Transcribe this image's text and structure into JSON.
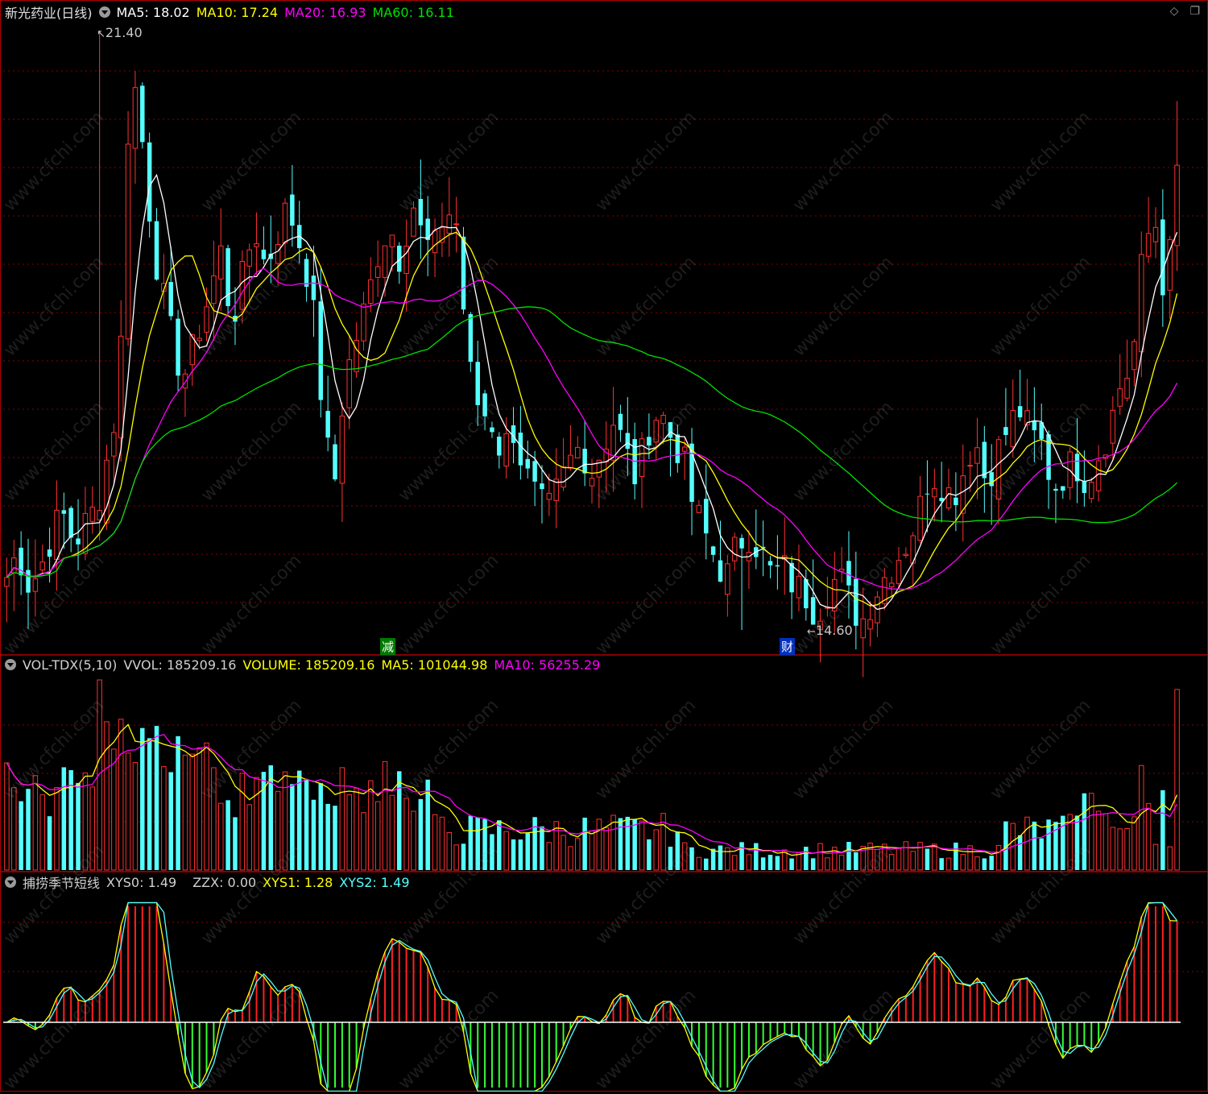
{
  "header_main": {
    "stock": "新光药业(日线)",
    "ma5": "MA5: 18.02",
    "ma10": "MA10: 17.24",
    "ma20": "MA20: 16.93",
    "ma60": "MA60: 16.11"
  },
  "header_vol": {
    "name": "VOL-TDX(5,10)",
    "vvol": "VVOL: 185209.16",
    "volume": "VOLUME: 185209.16",
    "ma5": "MA5: 101044.98",
    "ma10": "MA10: 56255.29"
  },
  "header_ind": {
    "name": "捕捞季节短线",
    "xys0": "XYS0: 1.49",
    "zzx": "ZZX: 0.00",
    "xys1": "XYS1: 1.28",
    "xys2": "XYS2: 1.49"
  },
  "annotations": {
    "high": "21.40",
    "low": "14.60",
    "tag_jian": "减",
    "tag_cai": "财"
  },
  "icons": [
    "diamond-icon",
    "restore-icon"
  ],
  "watermark": "www.cfchi.com",
  "colors": {
    "up": "#ff3030",
    "down": "#54ffff",
    "ma5": "#ffffff",
    "ma10": "#ffff00",
    "ma20": "#ff00ff",
    "ma60": "#00e000",
    "border": "#b00000",
    "grid": "#8a0000",
    "text": "#c8c8c8"
  },
  "chart_data": [
    {
      "type": "candlestick",
      "title": "新光药业(日线)",
      "high_label": 21.4,
      "low_label": 14.6,
      "close_path": [
        15.2,
        15.5,
        15.1,
        15.3,
        15.7,
        15.9,
        15.6,
        15.8,
        16.0,
        16.6,
        17.3,
        21.1,
        20.2,
        19.0,
        18.3,
        17.7,
        17.5,
        18.0,
        18.4,
        18.9,
        18.1,
        18.6,
        19.2,
        18.7,
        19.1,
        19.4,
        19.0,
        18.5,
        17.2,
        16.1,
        17.4,
        17.9,
        18.3,
        18.9,
        19.2,
        18.8,
        19.5,
        19.0,
        18.9,
        19.4,
        19.2,
        17.6,
        17.1,
        17.0,
        16.6,
        16.9,
        16.4,
        16.1,
        15.9,
        16.2,
        16.5,
        16.7,
        16.4,
        16.7,
        17.0,
        16.6,
        16.3,
        16.9,
        17.1,
        16.8,
        16.6,
        16.0,
        15.7,
        15.4,
        15.2,
        15.6,
        15.7,
        15.5,
        15.2,
        15.3,
        15.1,
        15.0,
        14.8,
        15.1,
        15.2,
        14.9,
        14.7,
        15.0,
        15.2,
        15.4,
        15.6,
        15.9,
        16.4,
        16.3,
        16.1,
        16.4,
        16.8,
        16.3,
        16.6,
        16.9,
        17.1,
        16.8,
        16.7,
        16.2,
        16.4,
        16.5,
        16.3,
        16.6,
        16.9,
        17.4,
        17.6,
        18.9,
        19.3,
        18.3,
        19.8
      ]
    },
    {
      "type": "bar",
      "title": "VOL-TDX(5,10)",
      "series": [
        {
          "name": "VOLUME",
          "last": 185209.16
        },
        {
          "name": "MA5",
          "last": 101044.98
        },
        {
          "name": "MA10",
          "last": 56255.29
        }
      ]
    },
    {
      "type": "bar",
      "title": "捕捞季节短线",
      "series": [
        {
          "name": "XYS0",
          "last": 1.49
        },
        {
          "name": "ZZX",
          "last": 0.0
        },
        {
          "name": "XYS1",
          "last": 1.28
        },
        {
          "name": "XYS2",
          "last": 1.49
        }
      ]
    }
  ]
}
